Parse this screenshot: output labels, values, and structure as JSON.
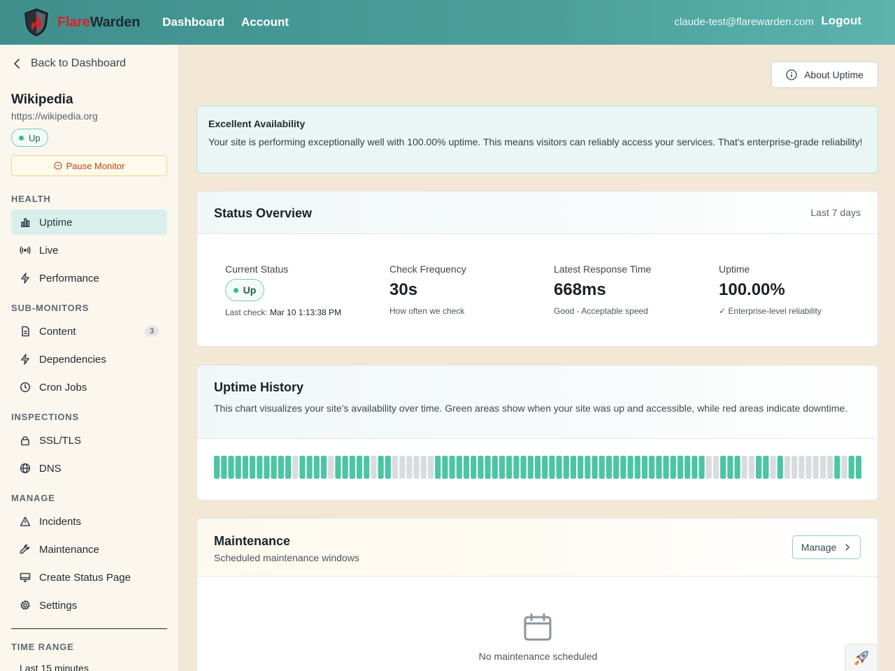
{
  "header": {
    "brand_part1": "Flare",
    "brand_part2": "Warden",
    "nav": [
      "Dashboard",
      "Account"
    ],
    "user_email": "claude-test@flarewarden.com",
    "logout_label": "Logout",
    "logo_icon": "shield-flame-icon"
  },
  "sidebar": {
    "back_label": "Back to Dashboard",
    "site_name": "Wikipedia",
    "site_url": "https://wikipedia.org",
    "status": "Up",
    "pause_label": "Pause Monitor",
    "sections": {
      "health": "HEALTH",
      "sub_monitors": "SUB-MONITORS",
      "inspections": "INSPECTIONS",
      "manage": "MANAGE",
      "time_range": "TIME RANGE"
    },
    "items": {
      "uptime": "Uptime",
      "live": "Live",
      "performance": "Performance",
      "content": "Content",
      "content_count": "3",
      "dependencies": "Dependencies",
      "cron_jobs": "Cron Jobs",
      "ssl": "SSL/TLS",
      "dns": "DNS",
      "incidents": "Incidents",
      "maintenance": "Maintenance",
      "status_page": "Create Status Page",
      "settings": "Settings"
    },
    "time_range_value": "Last 15 minutes"
  },
  "main": {
    "about_label": "About Uptime",
    "alert": {
      "title": "Excellent Availability",
      "body": "Your site is performing exceptionally well with 100.00% uptime. This means visitors can reliably access your services. That's enterprise-grade reliability!"
    },
    "status_overview": {
      "title": "Status Overview",
      "period": "Last 7 days",
      "current_status_label": "Current Status",
      "current_status": "Up",
      "last_check_label": "Last check:",
      "last_check_value": "Mar 10 1:13:38 PM",
      "frequency_label": "Check Frequency",
      "frequency_value": "30s",
      "frequency_sub": "How often we check",
      "response_label": "Latest Response Time",
      "response_value": "668ms",
      "response_sub": "Good - Acceptable speed",
      "uptime_label": "Uptime",
      "uptime_value": "100.00%",
      "uptime_sub": "✓ Enterprise-level reliability"
    },
    "uptime_history": {
      "title": "Uptime History",
      "description": "This chart visualizes your site's availability over time. Green areas show when your site was up and accessible, while red areas indicate downtime.",
      "colors": {
        "up": "#4cc5a3",
        "no_data": "#d9dcde"
      },
      "segments": [
        "up",
        "up",
        "up",
        "up",
        "up",
        "up",
        "up",
        "up",
        "up",
        "up",
        "up",
        "none",
        "up",
        "up",
        "up",
        "up",
        "none",
        "up",
        "up",
        "up",
        "up",
        "up",
        "none",
        "up",
        "up",
        "none",
        "none",
        "none",
        "none",
        "none",
        "none",
        "up",
        "up",
        "up",
        "up",
        "up",
        "up",
        "up",
        "up",
        "up",
        "up",
        "up",
        "up",
        "up",
        "up",
        "up",
        "up",
        "up",
        "up",
        "up",
        "up",
        "up",
        "up",
        "up",
        "up",
        "up",
        "up",
        "up",
        "up",
        "up",
        "up",
        "up",
        "up",
        "up",
        "up",
        "up",
        "up",
        "up",
        "up",
        "none",
        "none",
        "up",
        "up",
        "up",
        "none",
        "none",
        "up",
        "up",
        "none",
        "up",
        "none",
        "none",
        "none",
        "none",
        "none",
        "none",
        "none",
        "up",
        "none",
        "up",
        "up"
      ]
    },
    "maintenance": {
      "title": "Maintenance",
      "subtitle": "Scheduled maintenance windows",
      "manage_label": "Manage",
      "empty_text": "No maintenance scheduled"
    }
  }
}
